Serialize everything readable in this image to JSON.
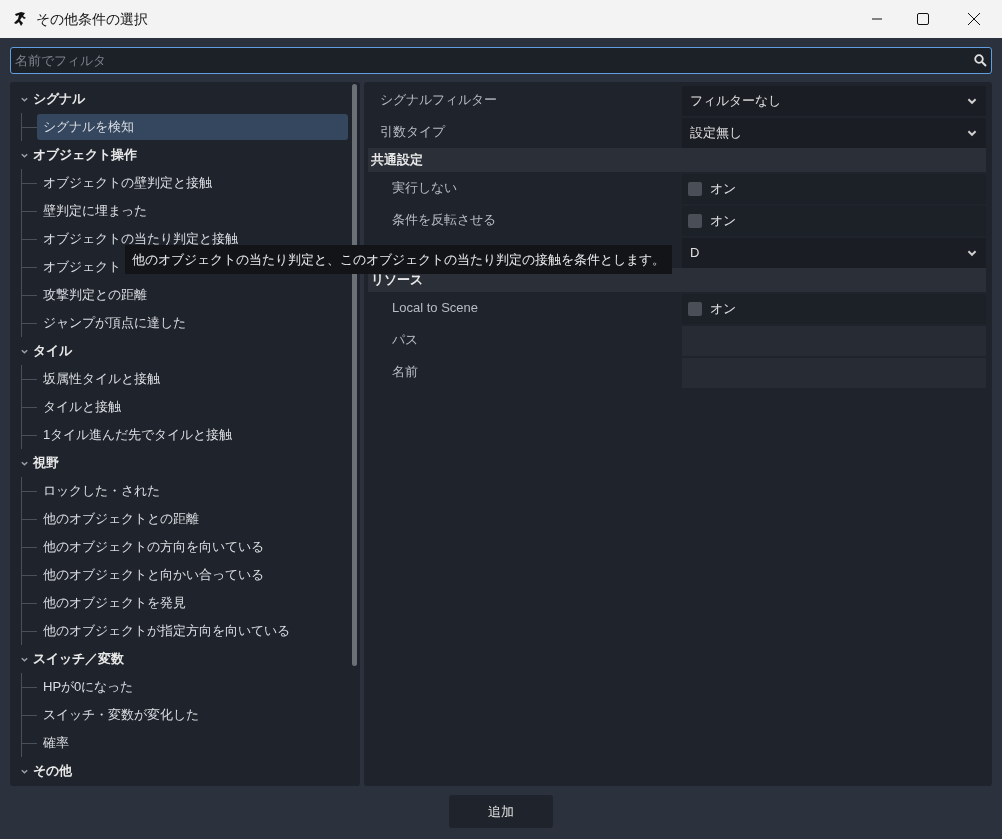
{
  "window": {
    "title": "その他条件の選択"
  },
  "filter": {
    "placeholder": "名前でフィルタ"
  },
  "tree": [
    {
      "label": "シグナル",
      "expanded": true,
      "children": [
        {
          "label": "シグナルを検知",
          "selected": true
        }
      ]
    },
    {
      "label": "オブジェクト操作",
      "expanded": true,
      "children": [
        {
          "label": "オブジェクトの壁判定と接触",
          "selected": false
        },
        {
          "label": "壁判定に埋まった",
          "selected": false
        },
        {
          "label": "オブジェクトの当たり判定と接触",
          "selected": false
        },
        {
          "label": "オブジェクト",
          "selected": false
        },
        {
          "label": "攻撃判定との距離",
          "selected": false
        },
        {
          "label": "ジャンプが頂点に達した",
          "selected": false
        }
      ]
    },
    {
      "label": "タイル",
      "expanded": true,
      "children": [
        {
          "label": "坂属性タイルと接触",
          "selected": false
        },
        {
          "label": "タイルと接触",
          "selected": false
        },
        {
          "label": "1タイル進んだ先でタイルと接触",
          "selected": false
        }
      ]
    },
    {
      "label": "視野",
      "expanded": true,
      "children": [
        {
          "label": "ロックした・された",
          "selected": false
        },
        {
          "label": "他のオブジェクトとの距離",
          "selected": false
        },
        {
          "label": "他のオブジェクトの方向を向いている",
          "selected": false
        },
        {
          "label": "他のオブジェクトと向かい合っている",
          "selected": false
        },
        {
          "label": "他のオブジェクトを発見",
          "selected": false
        },
        {
          "label": "他のオブジェクトが指定方向を向いている",
          "selected": false
        }
      ]
    },
    {
      "label": "スイッチ／変数",
      "expanded": true,
      "children": [
        {
          "label": "HPが0になった",
          "selected": false
        },
        {
          "label": "スイッチ・変数が変化した",
          "selected": false
        },
        {
          "label": "確率",
          "selected": false
        }
      ]
    },
    {
      "label": "その他",
      "expanded": true
    }
  ],
  "properties": [
    {
      "kind": "dropdown",
      "label": "シグナルフィルター",
      "value": "フィルターなし"
    },
    {
      "kind": "dropdown",
      "label": "引数タイプ",
      "value": "設定無し"
    }
  ],
  "sections": [
    {
      "label": "共通設定",
      "rows": [
        {
          "kind": "checkbox",
          "label": "実行しない",
          "text": "オン",
          "checked": false
        },
        {
          "kind": "checkbox",
          "label": "条件を反転させる",
          "text": "オン",
          "checked": false
        },
        {
          "kind": "dropdown",
          "value": "D"
        }
      ]
    },
    {
      "label": "リソース",
      "rows": [
        {
          "kind": "checkbox",
          "label": "Local to Scene",
          "text": "オン",
          "checked": false
        },
        {
          "kind": "text",
          "label": "パス"
        },
        {
          "kind": "text",
          "label": "名前"
        }
      ]
    }
  ],
  "tooltip": "他のオブジェクトの当たり判定と、このオブジェクトの当たり判定の接触を条件とします。",
  "add_button": "追加"
}
